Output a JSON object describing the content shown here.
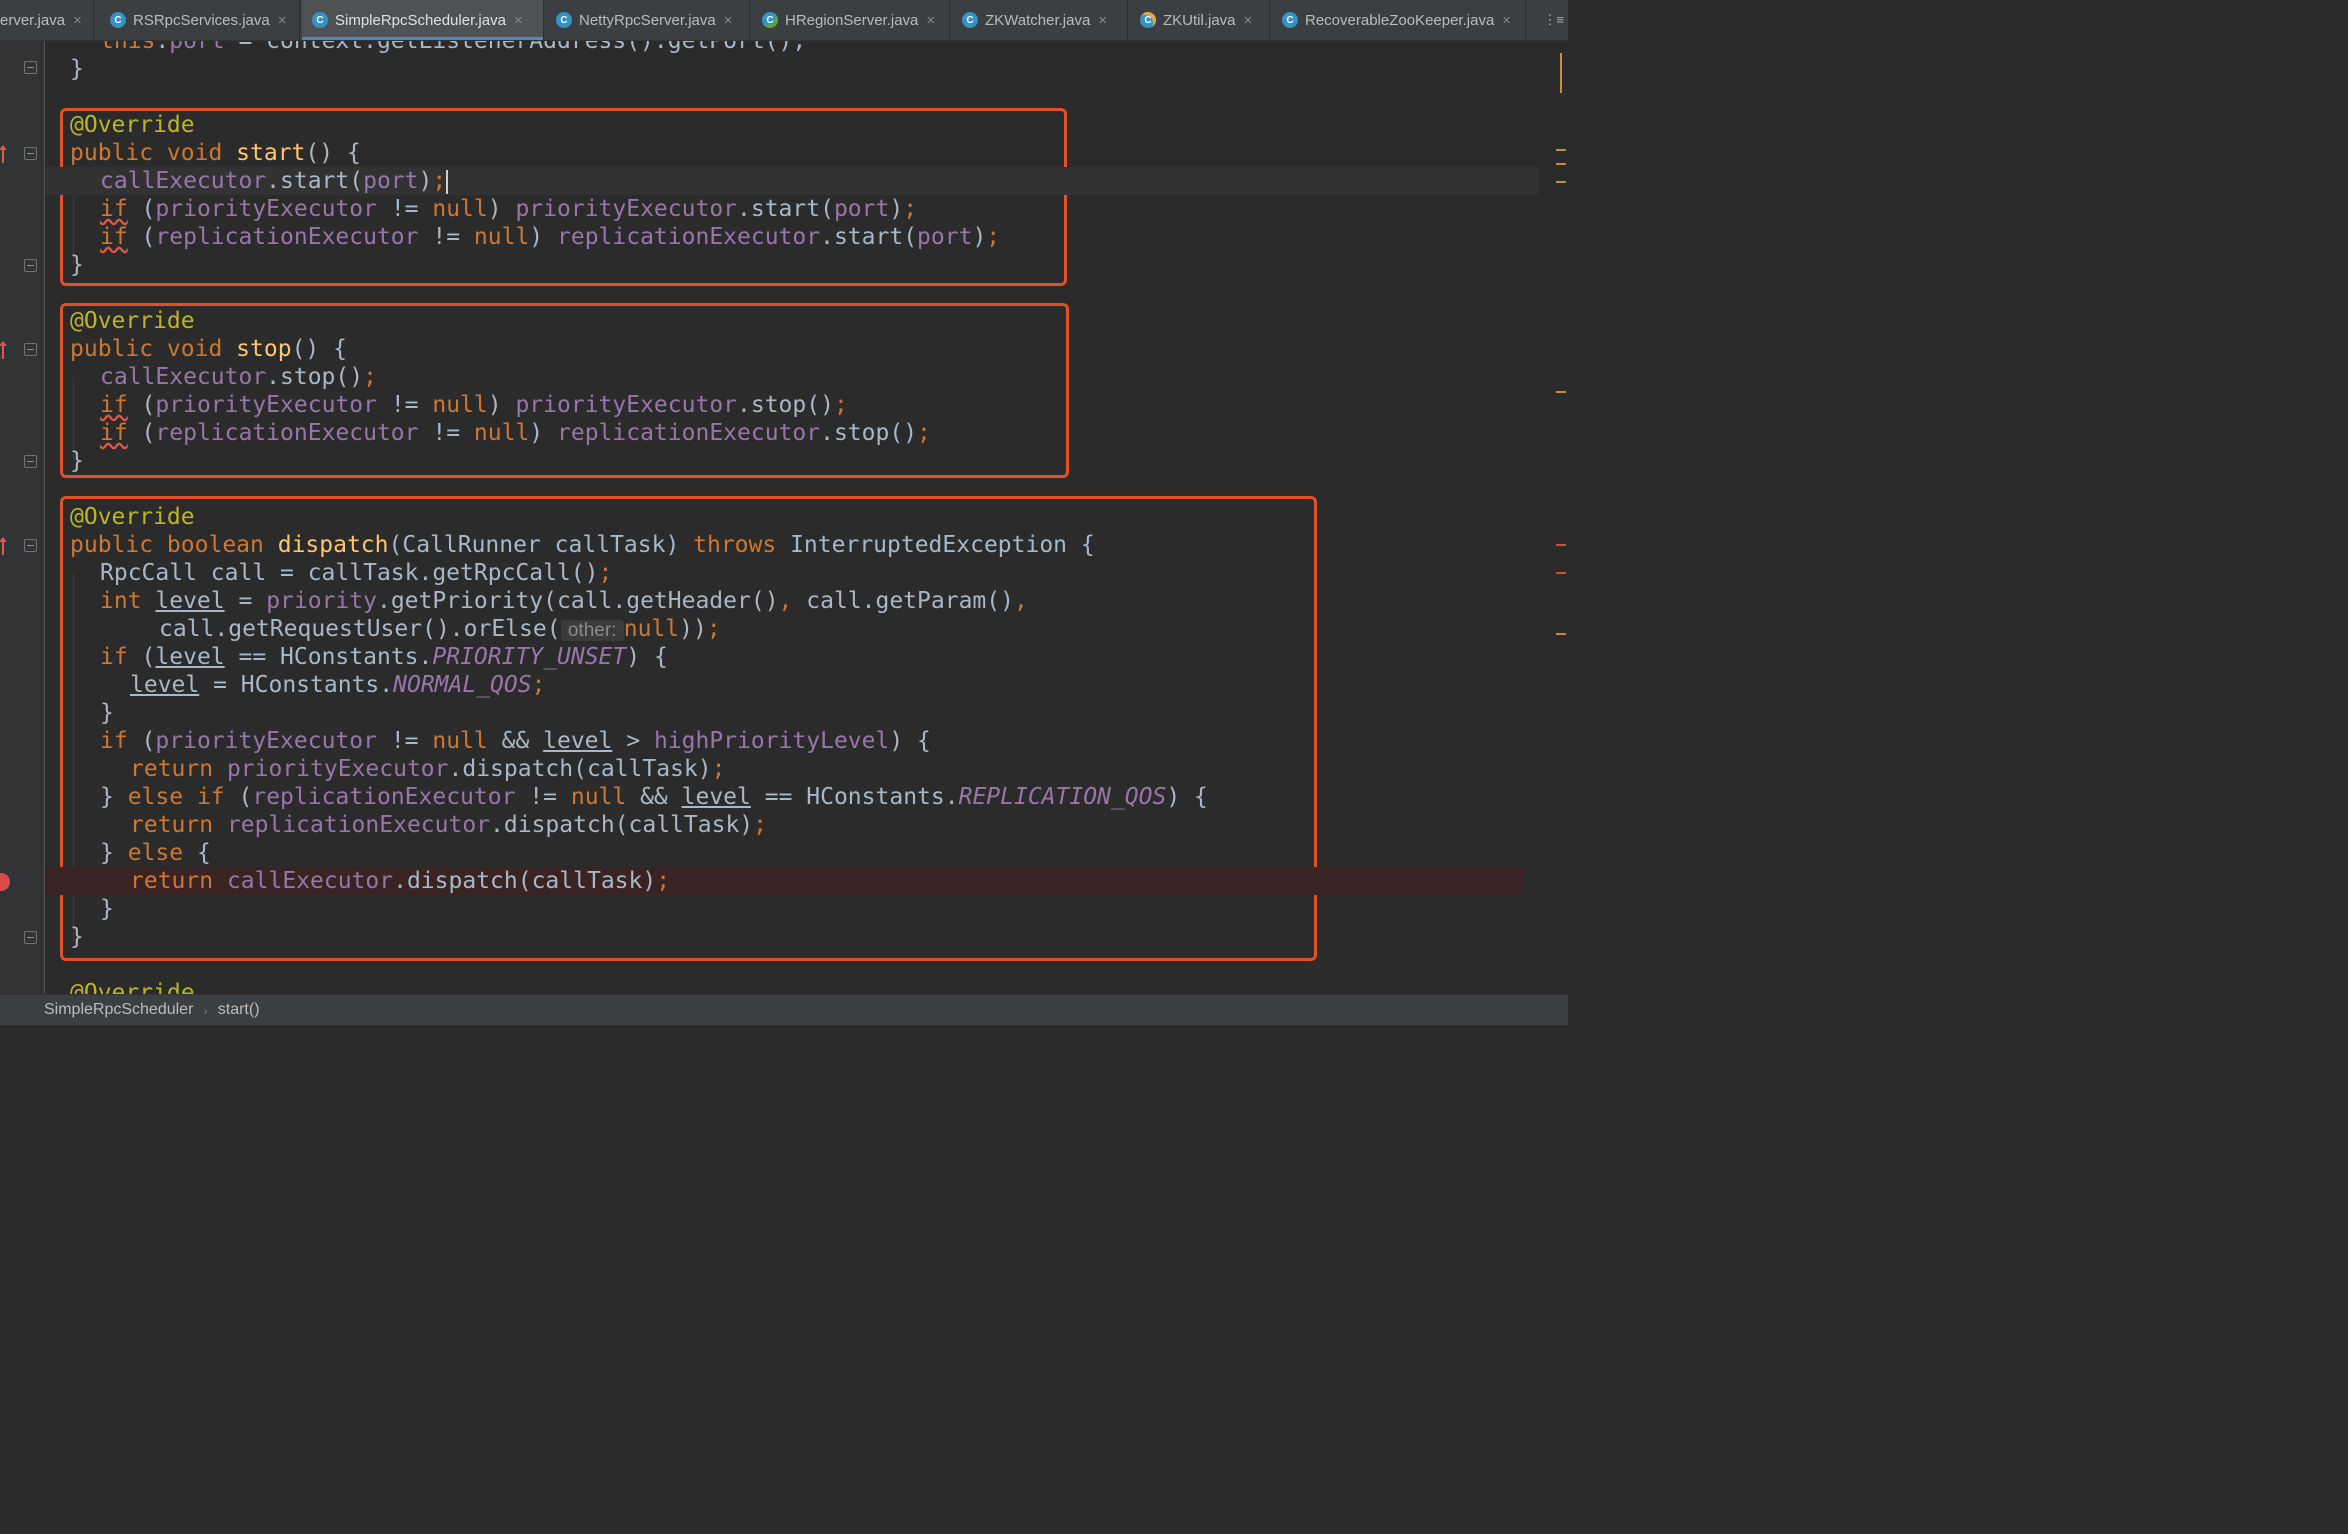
{
  "tabs": [
    {
      "label": "erver.java",
      "icon": "none",
      "active": false
    },
    {
      "label": "RSRpcServices.java",
      "icon": "class-icon",
      "active": false
    },
    {
      "label": "SimpleRpcScheduler.java",
      "icon": "class-icon",
      "active": true
    },
    {
      "label": "NettyRpcServer.java",
      "icon": "class-icon",
      "active": false
    },
    {
      "label": "HRegionServer.java",
      "icon": "runnable-class-icon",
      "active": false
    },
    {
      "label": "ZKWatcher.java",
      "icon": "class-icon",
      "active": false
    },
    {
      "label": "ZKUtil.java",
      "icon": "locked-class-icon",
      "active": false
    },
    {
      "label": "RecoverableZooKeeper.java",
      "icon": "class-icon",
      "active": false
    }
  ],
  "tab_close_glyph": "×",
  "tab_menu_glyph": "⋮≡",
  "icon_glyph": "C",
  "code": {
    "top_partial": [
      [
        "kw",
        "this"
      ],
      [
        "",
        "."
      ],
      [
        "fld",
        "port"
      ],
      [
        "",
        " = context.getListenerAddress().getPort();"
      ]
    ],
    "l2": [
      [
        "",
        "}"
      ]
    ],
    "start_ann": [
      [
        "ann",
        "@Override"
      ]
    ],
    "start_sig": [
      [
        "kw",
        "public void "
      ],
      [
        "fn",
        "start"
      ],
      [
        "",
        "() {"
      ]
    ],
    "start_l1": [
      [
        "fld",
        "callExecutor"
      ],
      [
        "",
        ".start("
      ],
      [
        "fld",
        "port"
      ],
      [
        "",
        ")"
      ],
      [
        "kw",
        ";"
      ]
    ],
    "start_l2": [
      [
        "kwwarn",
        "if"
      ],
      [
        "",
        " ("
      ],
      [
        "fld",
        "priorityExecutor"
      ],
      [
        "",
        " != "
      ],
      [
        "kw",
        "null"
      ],
      [
        "",
        ") "
      ],
      [
        "fld",
        "priorityExecutor"
      ],
      [
        "",
        ".start("
      ],
      [
        "fld",
        "port"
      ],
      [
        "",
        ")"
      ],
      [
        "kw",
        ";"
      ]
    ],
    "start_l3": [
      [
        "kwwarn",
        "if"
      ],
      [
        "",
        " ("
      ],
      [
        "fld",
        "replicationExecutor"
      ],
      [
        "",
        " != "
      ],
      [
        "kw",
        "null"
      ],
      [
        "",
        ") "
      ],
      [
        "fld",
        "replicationExecutor"
      ],
      [
        "",
        ".start("
      ],
      [
        "fld",
        "port"
      ],
      [
        "",
        ")"
      ],
      [
        "kw",
        ";"
      ]
    ],
    "start_end": [
      [
        "",
        "}"
      ]
    ],
    "stop_ann": [
      [
        "ann",
        "@Override"
      ]
    ],
    "stop_sig": [
      [
        "kw",
        "public void "
      ],
      [
        "fn",
        "stop"
      ],
      [
        "",
        "() {"
      ]
    ],
    "stop_l1": [
      [
        "fld",
        "callExecutor"
      ],
      [
        "",
        ".stop()"
      ],
      [
        "kw",
        ";"
      ]
    ],
    "stop_l2": [
      [
        "kwwarn",
        "if"
      ],
      [
        "",
        " ("
      ],
      [
        "fld",
        "priorityExecutor"
      ],
      [
        "",
        " != "
      ],
      [
        "kw",
        "null"
      ],
      [
        "",
        ") "
      ],
      [
        "fld",
        "priorityExecutor"
      ],
      [
        "",
        ".stop()"
      ],
      [
        "kw",
        ";"
      ]
    ],
    "stop_l3": [
      [
        "kwwarn",
        "if"
      ],
      [
        "",
        " ("
      ],
      [
        "fld",
        "replicationExecutor"
      ],
      [
        "",
        " != "
      ],
      [
        "kw",
        "null"
      ],
      [
        "",
        ") "
      ],
      [
        "fld",
        "replicationExecutor"
      ],
      [
        "",
        ".stop()"
      ],
      [
        "kw",
        ";"
      ]
    ],
    "stop_end": [
      [
        "",
        "}"
      ]
    ],
    "disp_ann": [
      [
        "ann",
        "@Override"
      ]
    ],
    "disp_sig": [
      [
        "kw",
        "public boolean "
      ],
      [
        "fn",
        "dispatch"
      ],
      [
        "",
        "(CallRunner callTask) "
      ],
      [
        "kw",
        "throws"
      ],
      [
        "",
        " InterruptedException {"
      ]
    ],
    "d1": [
      [
        "",
        "RpcCall call = callTask.getRpcCall()"
      ],
      [
        "kw",
        ";"
      ]
    ],
    "d2": [
      [
        "kw",
        "int "
      ],
      [
        "und",
        "level"
      ],
      [
        "",
        " = "
      ],
      [
        "fld",
        "priority"
      ],
      [
        "",
        ".getPriority(call.getHeader()"
      ],
      [
        "kw",
        ","
      ],
      [
        "",
        " call.getParam()"
      ],
      [
        "kw",
        ","
      ]
    ],
    "d3": [
      [
        "",
        "call.getRequestUser().orElse("
      ],
      [
        "hint",
        " other: "
      ],
      [
        "kw",
        "null"
      ],
      [
        "",
        "))"
      ],
      [
        "kw",
        ";"
      ]
    ],
    "d4": [
      [
        "kw",
        "if"
      ],
      [
        "",
        " ("
      ],
      [
        "und",
        "level"
      ],
      [
        "",
        " == HConstants."
      ],
      [
        "cst",
        "PRIORITY_UNSET"
      ],
      [
        "",
        ") {"
      ]
    ],
    "d5": [
      [
        "und",
        "level"
      ],
      [
        "",
        " = HConstants."
      ],
      [
        "cst",
        "NORMAL_QOS"
      ],
      [
        "kw",
        ";"
      ]
    ],
    "d6": [
      [
        "",
        "}"
      ]
    ],
    "d7": [
      [
        "kw",
        "if"
      ],
      [
        "",
        " ("
      ],
      [
        "fld",
        "priorityExecutor"
      ],
      [
        "",
        " != "
      ],
      [
        "kw",
        "null"
      ],
      [
        "",
        " && "
      ],
      [
        "und",
        "level"
      ],
      [
        "",
        " > "
      ],
      [
        "fld",
        "highPriorityLevel"
      ],
      [
        "",
        ") {"
      ]
    ],
    "d8": [
      [
        "kw",
        "return "
      ],
      [
        "fld",
        "priorityExecutor"
      ],
      [
        "",
        ".dispatch(callTask)"
      ],
      [
        "kw",
        ";"
      ]
    ],
    "d9": [
      [
        "",
        "} "
      ],
      [
        "kw",
        "else if"
      ],
      [
        "",
        " ("
      ],
      [
        "fld",
        "replicationExecutor"
      ],
      [
        "",
        " != "
      ],
      [
        "kw",
        "null"
      ],
      [
        "",
        " && "
      ],
      [
        "und",
        "level"
      ],
      [
        "",
        " == HConstants."
      ],
      [
        "cst",
        "REPLICATION_QOS"
      ],
      [
        "",
        ") {"
      ]
    ],
    "d10": [
      [
        "kw",
        "return "
      ],
      [
        "fld",
        "replicationExecutor"
      ],
      [
        "",
        ".dispatch(callTask)"
      ],
      [
        "kw",
        ";"
      ]
    ],
    "d11": [
      [
        "",
        "} "
      ],
      [
        "kw",
        "else"
      ],
      [
        "",
        " {"
      ]
    ],
    "d12": [
      [
        "kw",
        "return "
      ],
      [
        "fld",
        "callExecutor"
      ],
      [
        "",
        ".dispatch(callTask)"
      ],
      [
        "kw",
        ";"
      ]
    ],
    "d13": [
      [
        "",
        "}"
      ]
    ],
    "d14": [
      [
        "",
        "}"
      ]
    ],
    "next_ann": [
      [
        "ann",
        "@Override"
      ]
    ]
  },
  "breadcrumb": {
    "class_name": "SimpleRpcScheduler",
    "separator": "›",
    "method": "start()"
  },
  "colors": {
    "highlight_box": "#e2502a",
    "keyword": "#cc7832",
    "annotation": "#bbb529",
    "method": "#ffc66d",
    "field": "#9876aa"
  }
}
